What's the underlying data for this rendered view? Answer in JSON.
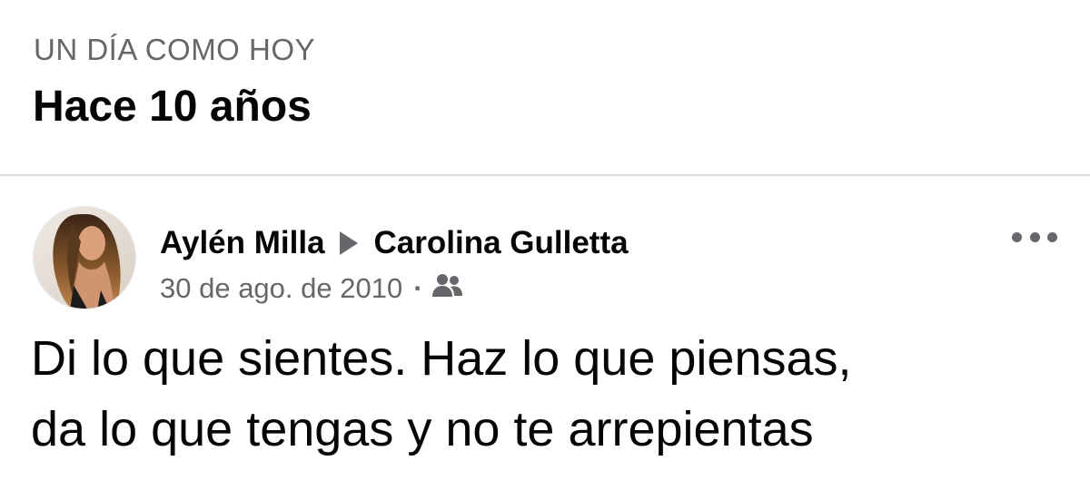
{
  "memories": {
    "kicker": "UN DÍA COMO HOY",
    "title": "Hace 10 años"
  },
  "post": {
    "author": "Aylén Milla",
    "recipient": "Carolina Gulletta",
    "date": "30 de ago. de 2010",
    "separator": "·",
    "audience_icon": "friends-icon",
    "more_icon": "more-options-icon",
    "text_lines": [
      "Di lo que sientes. Haz lo que piensas,",
      "da lo que tengas y no te arrepientas"
    ]
  },
  "colors": {
    "primary_text": "#050505",
    "secondary_text": "#65676b",
    "divider": "#dadde1",
    "background": "#ffffff"
  }
}
